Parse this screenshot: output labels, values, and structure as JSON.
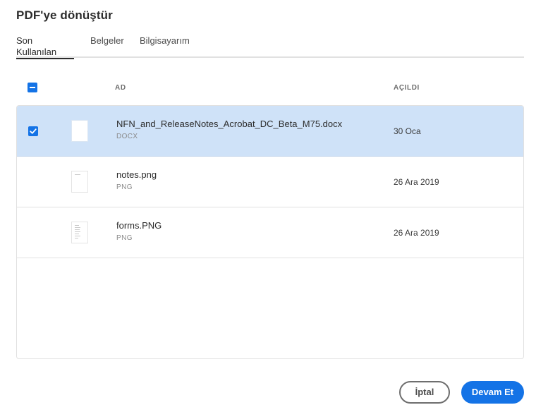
{
  "dialog": {
    "title": "PDF'ye dönüştür"
  },
  "tabs": [
    {
      "label": "Son Kullanılan",
      "active": true
    },
    {
      "label": "Belgeler",
      "active": false
    },
    {
      "label": "Bilgisayarım",
      "active": false
    }
  ],
  "table": {
    "header_name": "AD",
    "header_opened": "AÇILDI",
    "select_all_state": "indeterminate"
  },
  "files": [
    {
      "name": "NFN_and_ReleaseNotes_Acrobat_DC_Beta_M75.docx",
      "type": "DOCX",
      "opened": "30 Oca",
      "selected": true
    },
    {
      "name": "notes.png",
      "type": "PNG",
      "opened": "26 Ara 2019",
      "selected": false
    },
    {
      "name": "forms.PNG",
      "type": "PNG",
      "opened": "26 Ara 2019",
      "selected": false
    }
  ],
  "buttons": {
    "cancel_label": "İptal",
    "continue_label": "Devam Et"
  },
  "colors": {
    "accent": "#1473e6",
    "selected_row": "#cfe2f8"
  }
}
